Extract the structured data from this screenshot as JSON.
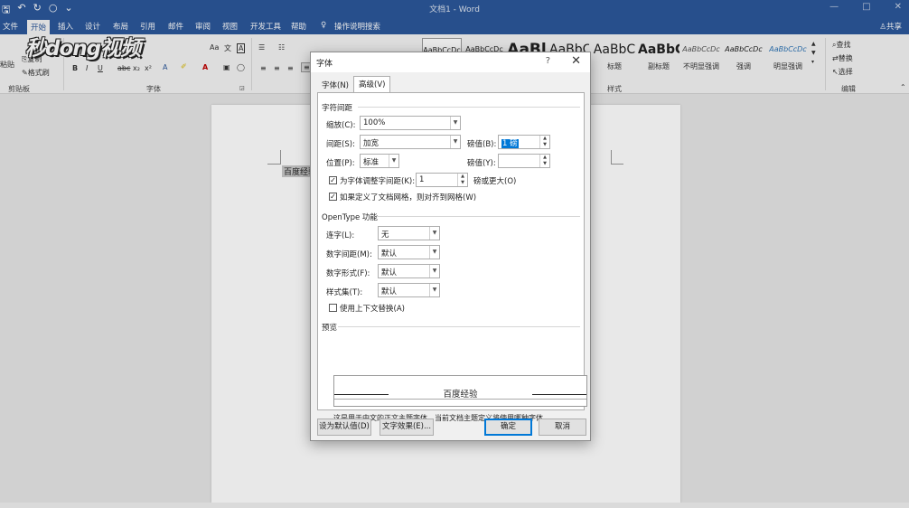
{
  "app": {
    "title": "文档1 - Word",
    "share_label": "共享",
    "qat": [
      "🖫",
      "↶",
      "↻",
      "○",
      "⌄"
    ],
    "window_controls": [
      "—",
      "□",
      "✕"
    ]
  },
  "tabs": [
    "文件",
    "开始",
    "插入",
    "设计",
    "布局",
    "引用",
    "邮件",
    "审阅",
    "视图",
    "开发工具",
    "帮助"
  ],
  "tell_me": "操作说明搜索",
  "ribbon": {
    "paste_label": "粘贴",
    "copy_label": "复制",
    "format_painter_label": "格式刷",
    "clipboard_group": "剪贴板",
    "font_group": "字体",
    "styles_group": "样式",
    "editing_group": "编辑",
    "find_label": "查找",
    "replace_label": "替换",
    "select_label": "选择",
    "styles": [
      {
        "sample": "AaBbCcDc",
        "name": ""
      },
      {
        "sample": "AaBbCcDc",
        "name": ""
      },
      {
        "sample": "AaBl",
        "name": ""
      },
      {
        "sample": "AaBbC",
        "name": ""
      },
      {
        "sample": "AaBbC",
        "name": "标题"
      },
      {
        "sample": "AaBbC",
        "name": "副标题"
      },
      {
        "sample": "AaBbCcDc",
        "name": "不明显强调"
      },
      {
        "sample": "AaBbCcDc",
        "name": "强调"
      },
      {
        "sample": "AaBbCcDc",
        "name": "明显强调"
      }
    ]
  },
  "watermark": "秒dong视频",
  "document": {
    "selected_text": "百度经验"
  },
  "dialog": {
    "title": "字体",
    "help": "?",
    "close": "✕",
    "tab_font": "字体(N)",
    "tab_advanced": "高级(V)",
    "char_spacing_section": "字符间距",
    "scale_label": "缩放(C):",
    "scale_value": "100%",
    "spacing_label": "间距(S):",
    "spacing_value": "加宽",
    "spacing_by_label": "磅值(B):",
    "spacing_by_value": "1 磅",
    "position_label": "位置(P):",
    "position_value": "标准",
    "position_by_label": "磅值(Y):",
    "position_by_value": "",
    "kerning_label": "为字体调整字间距(K):",
    "kerning_value": "1",
    "kerning_suffix": "磅或更大(O)",
    "kerning_checked": true,
    "grid_label": "如果定义了文档网格，则对齐到网格(W)",
    "grid_checked": true,
    "opentype_section": "OpenType 功能",
    "ligatures_label": "连字(L):",
    "ligatures_value": "无",
    "num_spacing_label": "数字间距(M):",
    "num_spacing_value": "默认",
    "num_forms_label": "数字形式(F):",
    "num_forms_value": "默认",
    "stylistic_label": "样式集(T):",
    "stylistic_value": "默认",
    "contextual_label": "使用上下文替换(A)",
    "contextual_checked": false,
    "preview_section": "预览",
    "preview_text": "百度经验",
    "preview_note": "这是用于中文的正文主题字体。当前文档主题定义将使用哪种字体。",
    "btn_default": "设为默认值(D)",
    "btn_effects": "文字效果(E)...",
    "btn_ok": "确定",
    "btn_cancel": "取消"
  }
}
